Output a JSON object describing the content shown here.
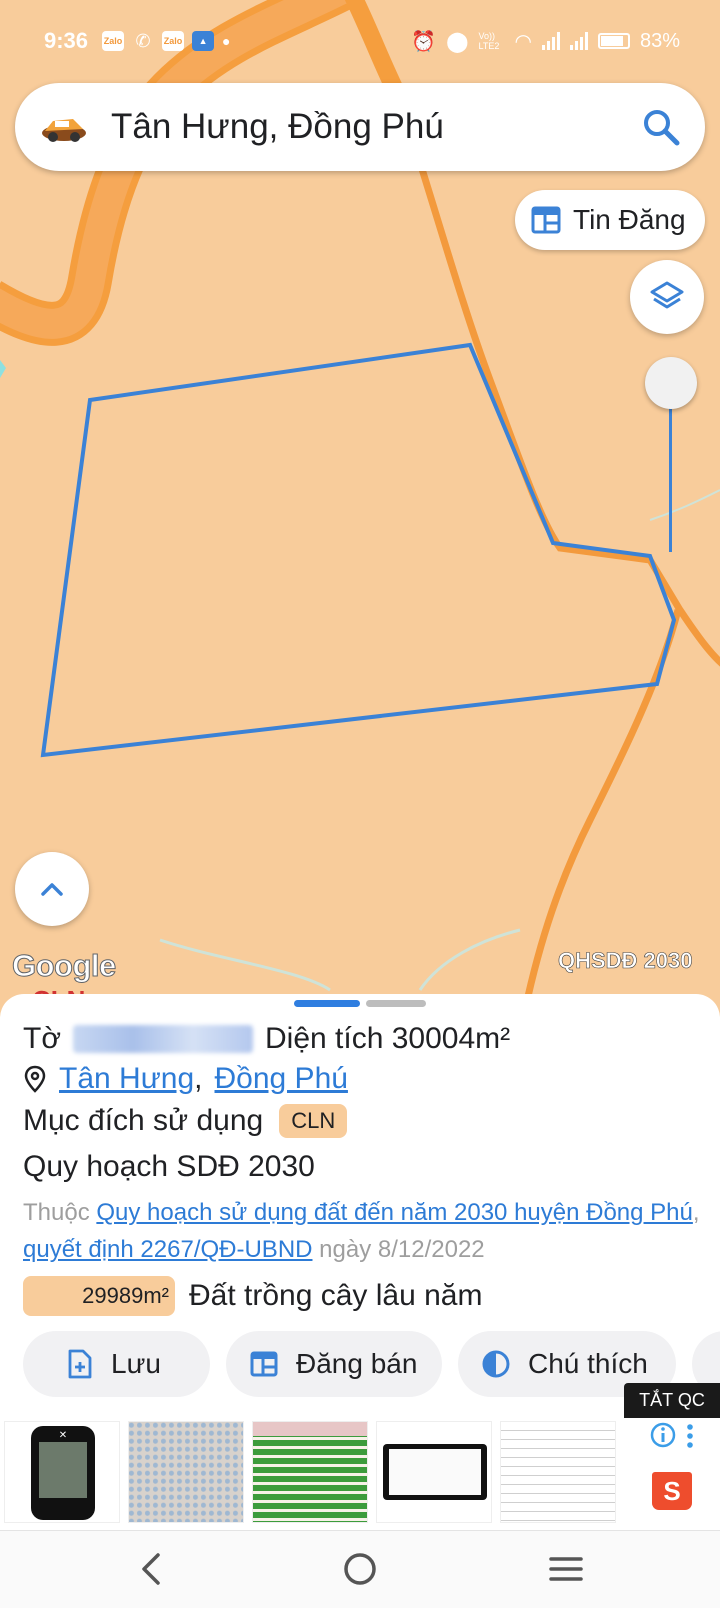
{
  "status_bar": {
    "time": "9:36",
    "apps": [
      "Zalo",
      "Messenger",
      "Zalo",
      "Gallery"
    ],
    "network": "Vo)) LTE2",
    "battery": "83%"
  },
  "search": {
    "text": "Tân Hưng, Đồng Phú",
    "logo_icon": "app-logo-car-icon",
    "search_icon": "search-icon"
  },
  "map": {
    "post_listing_button": "Tin Đăng",
    "layers_icon": "layers-icon",
    "collapse_icon": "chevron-up-icon",
    "attribution": "Google",
    "map_layer_tag": "QHSDĐ 2030",
    "land_code_label": "CLN",
    "land_color": "#f8cc9b",
    "road_color": "#f5a348",
    "parcel_color": "#3b82d6"
  },
  "sheet": {
    "sheet_label": "Tờ",
    "area_label": "Diện tích 30004m²",
    "location_ward": "Tân Hưng",
    "location_separator": ",",
    "location_district": "Đồng Phú",
    "purpose_label": "Mục đích sử dụng",
    "purpose_code": "CLN",
    "plan_title": "Quy hoạch SDĐ 2030",
    "note_prefix": "Thuộc",
    "note_link1": "Quy hoạch sử dụng đất đến năm 2030 huyện Đồng Phú",
    "note_comma": ",",
    "note_link2": "quyết định 2267/QĐ-UBND",
    "note_suffix": "ngày 8/12/2022",
    "area_chip": "29989m²",
    "area_type": "Đất trồng cây lâu năm"
  },
  "actions": [
    {
      "label": "Lưu",
      "icon": "add-file-icon"
    },
    {
      "label": "Đăng bán",
      "icon": "listing-icon"
    },
    {
      "label": "Chú thích",
      "icon": "half-circle-icon"
    }
  ],
  "ads": {
    "close_label": "TẮT QC",
    "info_icon": "info-icon",
    "menu_icon": "more-vertical-icon",
    "brand_icon": "shopping-bag-icon",
    "thumbnails": [
      "device-thumbnail",
      "particles-thumbnail",
      "price-table-thumbnail",
      "tablet-thumbnail",
      "document-thumbnail"
    ]
  },
  "nav": {
    "back_icon": "back-icon",
    "home_icon": "home-icon",
    "menu_icon": "recent-apps-icon"
  }
}
